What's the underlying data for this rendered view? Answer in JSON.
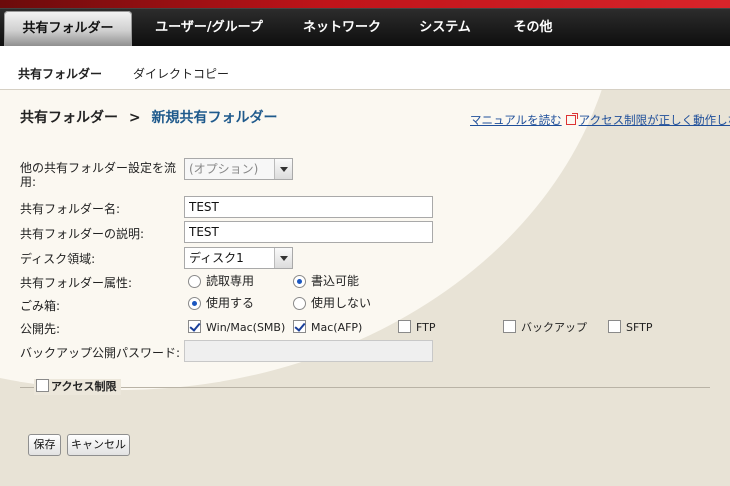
{
  "main_nav": {
    "items": [
      "共有フォルダー",
      "ユーザー/グループ",
      "ネットワーク",
      "システム",
      "その他"
    ]
  },
  "sub_nav": {
    "items": [
      "共有フォルダー",
      "ダイレクトコピー"
    ]
  },
  "breadcrumb": {
    "parent": "共有フォルダー",
    "separator": ">",
    "current": "新規共有フォルダー"
  },
  "links": {
    "manual": "マニュアルを読む",
    "access_issue": "アクセス制限が正しく動作しな"
  },
  "form": {
    "copy_settings_label": "他の共有フォルダー設定を流用:",
    "copy_settings_value": "(オプション)",
    "name_label": "共有フォルダー名:",
    "name_value": "TEST",
    "description_label": "共有フォルダーの説明:",
    "description_value": "TEST",
    "disk_label": "ディスク領域:",
    "disk_value": "ディスク1",
    "attribute_label": "共有フォルダー属性:",
    "attribute_options": [
      "読取専用",
      "書込可能"
    ],
    "attribute_selected": "書込可能",
    "trash_label": "ごみ箱:",
    "trash_options": [
      "使用する",
      "使用しない"
    ],
    "trash_selected": "使用する",
    "publish_label": "公開先:",
    "publish_options": [
      {
        "label": "Win/Mac(SMB)",
        "checked": true
      },
      {
        "label": "Mac(AFP)",
        "checked": true
      },
      {
        "label": "FTP",
        "checked": false
      },
      {
        "label": "バックアップ",
        "checked": false
      },
      {
        "label": "SFTP",
        "checked": false
      }
    ],
    "backup_password_label": "バックアップ公開パスワード:",
    "backup_password_value": ""
  },
  "access_restriction": {
    "label": "アクセス制限",
    "checked": false
  },
  "buttons": {
    "save": "保存",
    "cancel": "キャンセル"
  },
  "colors": {
    "nav_bg": "#141414",
    "brand_red": "#c0141a",
    "link": "#1f4f9a",
    "breadcrumb_current": "#1f5a8c"
  }
}
